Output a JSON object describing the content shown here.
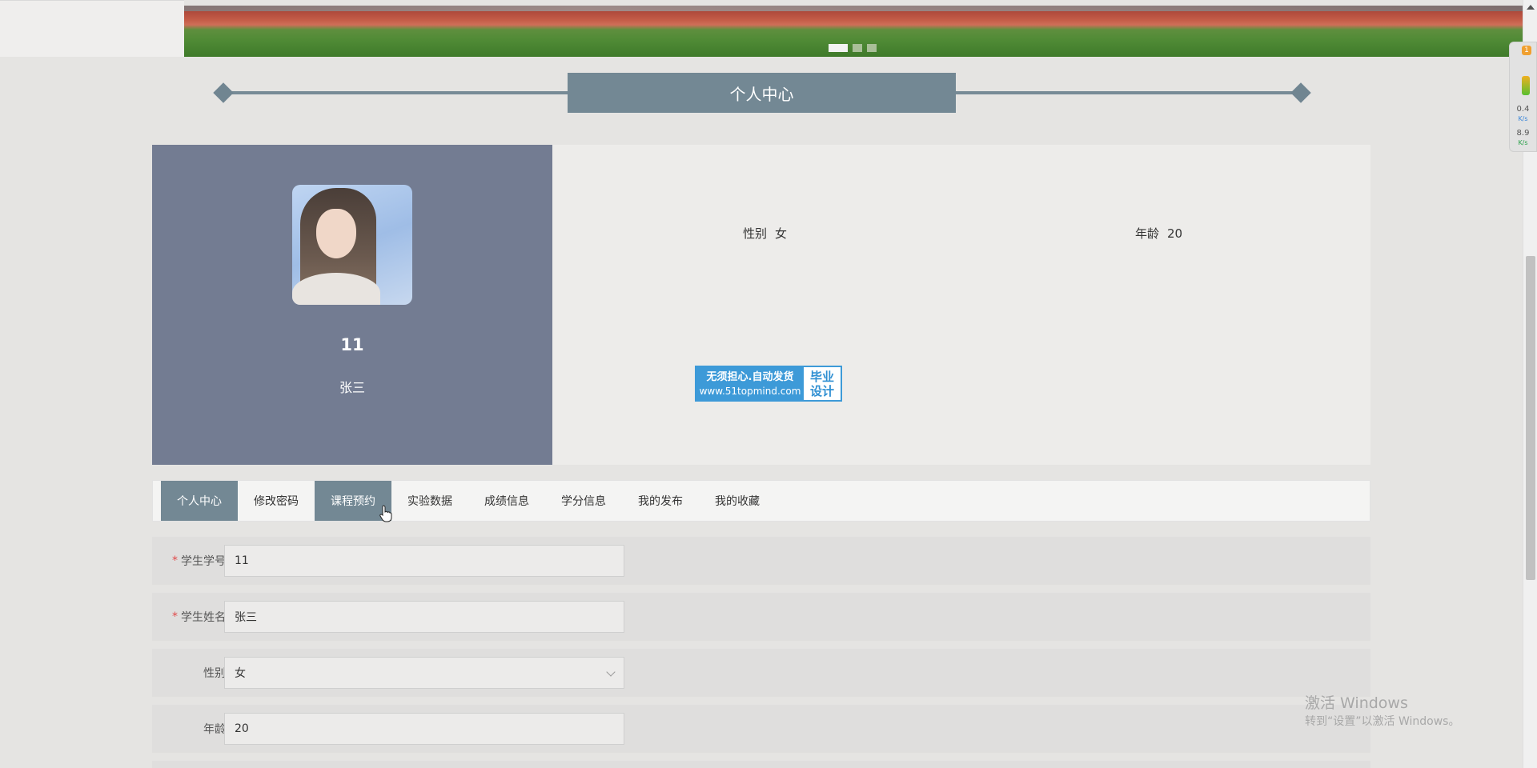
{
  "heading": {
    "title": "个人中心"
  },
  "banner": {
    "dots": 3,
    "active_dot": 0
  },
  "profile": {
    "student_id": "11",
    "name": "张三",
    "gender_label": "性别",
    "gender_value": "女",
    "age_label": "年龄",
    "age_value": "20"
  },
  "ad_badge": {
    "line1": "无须担心.自动发货",
    "line2": "www.51topmind.com",
    "right1": "毕业",
    "right2": "设计"
  },
  "tabs": [
    {
      "label": "个人中心",
      "active": true
    },
    {
      "label": "修改密码",
      "active": false
    },
    {
      "label": "课程预约",
      "active": true
    },
    {
      "label": "实验数据",
      "active": false
    },
    {
      "label": "成绩信息",
      "active": false
    },
    {
      "label": "学分信息",
      "active": false
    },
    {
      "label": "我的发布",
      "active": false
    },
    {
      "label": "我的收藏",
      "active": false
    }
  ],
  "form": {
    "student_id": {
      "label": "学生学号",
      "value": "11",
      "required": true
    },
    "student_name": {
      "label": "学生姓名",
      "value": "张三",
      "required": true
    },
    "gender": {
      "label": "性别",
      "value": "女",
      "required": false
    },
    "age": {
      "label": "年龄",
      "value": "20",
      "required": false
    },
    "required_mark": "*"
  },
  "net_widget": {
    "badge": "1",
    "up_value": "0.4",
    "up_unit": "K/s",
    "down_value": "8.9",
    "down_unit": "K/s"
  },
  "watermark": {
    "line1": "激活 Windows",
    "line2": "转到“设置”以激活 Windows。"
  },
  "colors": {
    "accent": "#738894",
    "profile_panel": "#737c92",
    "page_bg": "#e5e4e2",
    "badge_blue": "#3d9ad8",
    "required_red": "#e04a4a"
  }
}
